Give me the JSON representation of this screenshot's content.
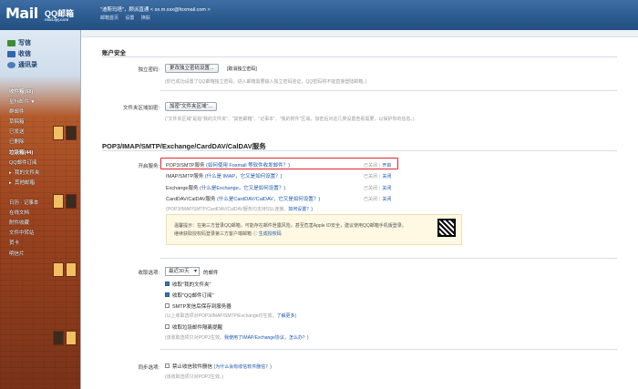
{
  "header": {
    "logo_mail": "Mail",
    "logo_qq": "QQ邮箱",
    "logo_domain": "mail.qq.com",
    "user": "\"迪斯玛塔\"，顾派直通 < xx.m.xxx@foxmail.com >",
    "links": [
      "邮箱首页",
      "设置",
      "换肤"
    ]
  },
  "sidebar": {
    "main": [
      {
        "label": "写信",
        "icon": "write-icon"
      },
      {
        "label": "收信",
        "icon": "inbox-icon"
      },
      {
        "label": "通讯录",
        "icon": "contacts-icon"
      }
    ],
    "folders": [
      {
        "label": "收件箱(68)",
        "bold": true
      },
      {
        "label": "星标邮件 ★"
      },
      {
        "label": "群邮件"
      },
      {
        "label": "草稿箱"
      },
      {
        "label": "已发送"
      },
      {
        "label": "已删除"
      },
      {
        "label": "垃圾箱(44)",
        "bold": true
      },
      {
        "label": "QQ邮件订阅"
      },
      {
        "label": "我的文件夹",
        "arrow": true
      },
      {
        "label": "其他邮箱",
        "arrow": true
      },
      {
        "label": ""
      },
      {
        "label": "日历 · 记事本"
      },
      {
        "label": "在线文档"
      },
      {
        "label": "附件收藏"
      },
      {
        "label": "文件中转站"
      },
      {
        "label": "贺卡"
      },
      {
        "label": "明信片"
      }
    ]
  },
  "account": {
    "title": "账户安全",
    "independent_label": "独立密码:",
    "independent_button": "更改独立密码设置...",
    "independent_link": "[取消独立密码]",
    "independent_note": "(你已成功设置了QQ邮箱独立密码，进入邮箱需要输入独立密码验证，QQ密码将不能直接登陆邮箱。)",
    "folder_label": "文件夹区域加密:",
    "folder_button": "加密\"文件夹区域\"...",
    "folder_note": "(\"文件夹区域\"是指\"我的文件夹\"、\"其他邮箱\"、\"记事本\"、\"我的附件\"区域，加密后对这几类设置查看需要，以保护你的信息。)"
  },
  "protocol": {
    "title": "POP3/IMAP/SMTP/Exchange/CardDAV/CalDAV服务",
    "open_label": "开启服务:",
    "services": [
      {
        "name": "POP3/SMTP服务",
        "help": "(如何使用 Foxmail 等软件收发邮件？)",
        "status": "已关闭",
        "action": "开启"
      },
      {
        "name": "IMAP/SMTP服务",
        "help": "(什么是 IMAP，它又是如何设置？)",
        "status": "已关闭",
        "action": "关闭"
      },
      {
        "name": "Exchange服务",
        "help": "(什么是Exchange，它又是如何设置？)",
        "status": "已关闭",
        "action": "关闭"
      },
      {
        "name": "CardDAV/CalDAV服务",
        "help": "(什么是CardDAV/CalDAV，它又是如何设置？)",
        "status": "已关闭",
        "action": "关闭"
      }
    ],
    "ssl_note": "(POP3/IMAP/SMTP/CardDAV/CalDAV服务均支持SSL连接。",
    "ssl_link": "如何设置？)",
    "tip_line1": "温馨提示：在第三方登录QQ邮箱，可能存在邮件泄露风险，甚至危害Apple ID安全，建议使用QQ邮箱手机版登录。",
    "tip_line2_prefix": "继续获取授权码登录第三方客户端邮箱 ⓘ",
    "tip_line2_link": "生成授权码"
  },
  "receive": {
    "label": "收取选项:",
    "select_value": "最近30天",
    "select_suffix": "的邮件",
    "opt1": "收取\"我的文件夹\"",
    "opt2": "收取\"QQ邮件订阅\"",
    "opt3": "SMTP发信后保存到服务器",
    "opt3_note": "(以上收取选项对POP3/IMAP/SMTP/Exchange均生效。",
    "opt3_link": "了解更多)",
    "opt4": "收取垃圾邮件隔离提醒",
    "opt4_note": "(该收取选项只对POP3生效。",
    "opt4_link": "我使用了IMAP/Exchange协议，怎么办？)"
  },
  "sync": {
    "label": "同步选项:",
    "opt1": "禁止收信软件删信",
    "opt1_link": "(为什么会有收信软件删信？)",
    "opt1_note": "(该收取选项只对POP3生效。)"
  }
}
